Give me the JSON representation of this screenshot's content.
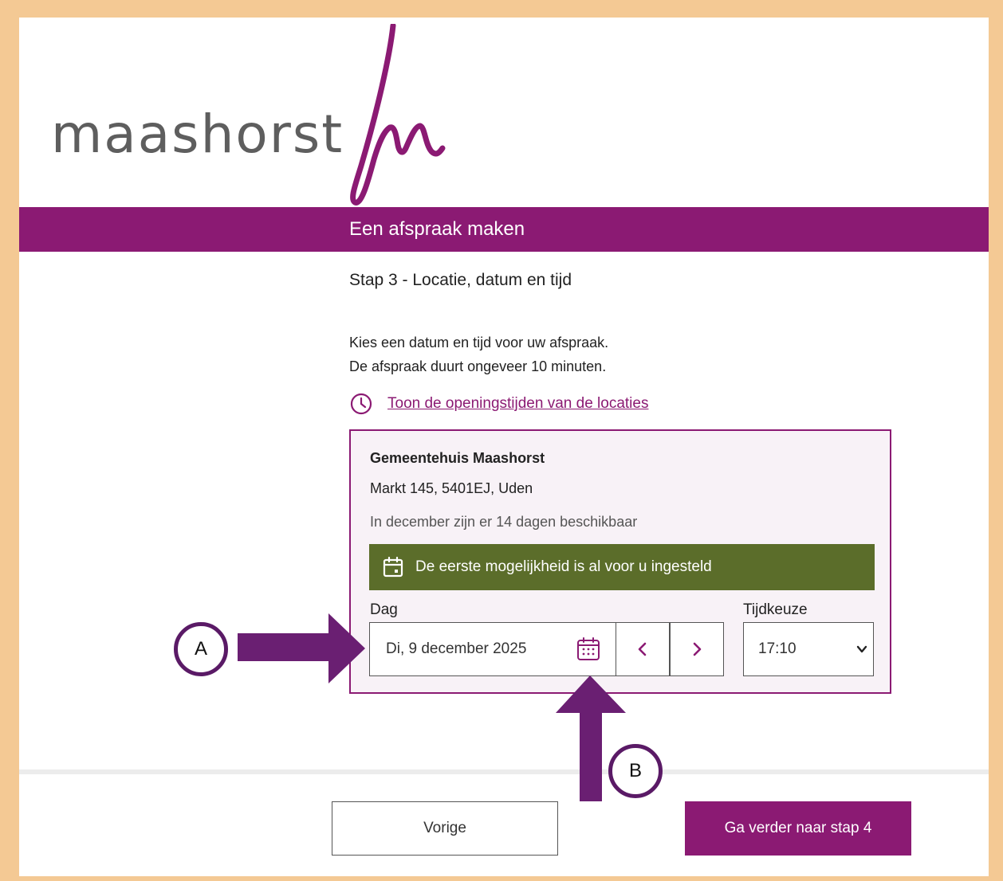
{
  "brand": {
    "logo_text": "maashorst",
    "color": "#8b1a73"
  },
  "header": {
    "title": "Een afspraak maken"
  },
  "step": {
    "title": "Stap 3 - Locatie, datum en tijd"
  },
  "intro": {
    "line1": "Kies een datum en tijd voor uw afspraak.",
    "line2": "De afspraak duurt ongeveer 10 minuten."
  },
  "hours_link": {
    "label": "Toon de openingstijden van de locaties",
    "icon": "clock-icon"
  },
  "location": {
    "name": "Gemeentehuis Maashorst",
    "address": "Markt 145, 5401EJ, Uden",
    "availability": "In december zijn er 14 dagen beschikbaar",
    "notice": "De eerste mogelijkheid is al voor u ingesteld",
    "notice_color": "#5b6d2a"
  },
  "date_picker": {
    "label": "Dag",
    "value": "Di, 9 december 2025",
    "prev_symbol": "‹",
    "next_symbol": "›",
    "calendar_icon": "calendar-icon"
  },
  "time_picker": {
    "label": "Tijdkeuze",
    "value": "17:10"
  },
  "footer": {
    "prev_label": "Vorige",
    "next_label": "Ga verder naar stap 4"
  },
  "annotations": {
    "marker_a": "A",
    "marker_b": "B",
    "arrow_color": "#6a1f72"
  }
}
